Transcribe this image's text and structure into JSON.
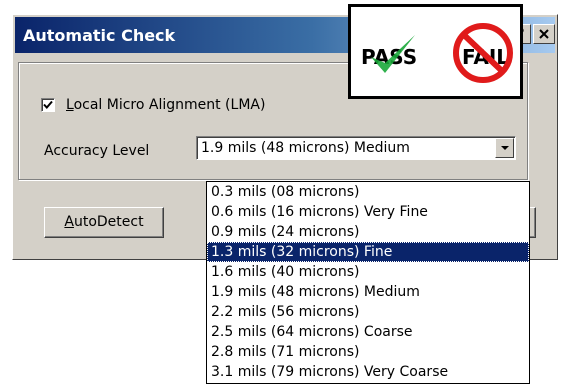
{
  "window": {
    "title": "Automatic Check",
    "help_glyph": "?",
    "close_glyph": "✕"
  },
  "lma_checkbox": {
    "label_underline": "L",
    "label_rest": "ocal Micro Alignment (LMA)",
    "checked": true
  },
  "accuracy": {
    "label": "Accuracy Level",
    "selected": "1.9 mils (48 microns) Medium"
  },
  "buttons": {
    "autodetect_underline": "A",
    "autodetect_rest": "utoDetect"
  },
  "dropdown": {
    "options": [
      "0.3 mils (08 microns)",
      "0.6 mils (16 microns) Very Fine",
      "0.9 mils (24 microns)",
      "1.3 mils (32 microns) Fine",
      "1.6 mils (40 microns)",
      "1.9 mils (48 microns) Medium",
      "2.2 mils (56 microns)",
      "2.5 mils (64 microns) Coarse",
      "2.8 mils (71 microns)",
      "3.1 mils (79 microns) Very Coarse"
    ],
    "highlighted_index": 3
  },
  "pass_fail": {
    "pass": "PASS",
    "fail": "FAIL",
    "check_icon": "checkmark-icon",
    "prohibition_icon": "no-symbol-icon",
    "colors": {
      "check": "#1aa83a",
      "prohibition": "#e01b1b"
    }
  }
}
